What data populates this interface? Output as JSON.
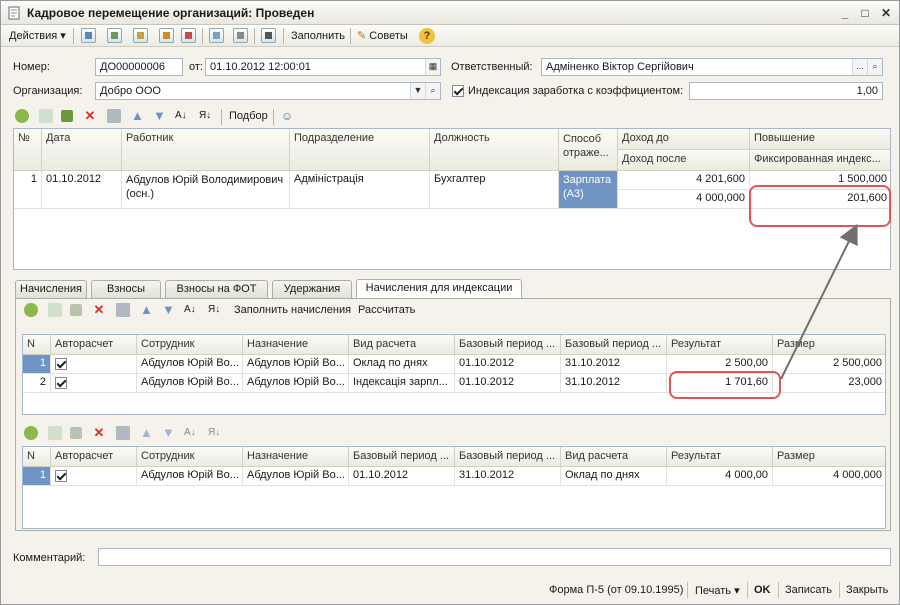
{
  "window": {
    "title": "Кадровое перемещение организаций: Проведен"
  },
  "toolbar": {
    "actions_label": "Действия",
    "fill_label": "Заполнить",
    "tips_label": "Советы"
  },
  "header": {
    "number_label": "Номер:",
    "number_value": "ДО00000006",
    "date_label": "от:",
    "date_value": "01.10.2012 12:00:01",
    "responsible_label": "Ответственный:",
    "responsible_value": "Адміненко Віктор Сергійович",
    "org_label": "Организация:",
    "org_value": "Добро ООО",
    "indexation_label": "Индексация заработка с коэффициентом:",
    "indexation_checked": true,
    "coefficient_value": "1,00"
  },
  "employees_toolbar": {
    "pick_label": "Подбор"
  },
  "employees_grid": {
    "headers": {
      "n": "№",
      "date": "Дата",
      "worker": "Работник",
      "department": "Подразделение",
      "position": "Должность",
      "method": "Способ отраже...",
      "income_before": "Доход до",
      "income_after": "Доход после",
      "increase": "Повышение",
      "fixed_index": "Фиксированная индекс..."
    },
    "rows": [
      {
        "n": "1",
        "date": "01.10.2012",
        "worker_line1": "Абдулов Юрій Володимирович",
        "worker_line2": "(осн.)",
        "department": "Адміністрація",
        "position": "Бухгалтер",
        "method_line1": "Зарплата",
        "method_line2": "(А3)",
        "income_before": "4 201,600",
        "income_after": "4 000,000",
        "increase": "1 500,000",
        "fixed_index": "201,600"
      }
    ]
  },
  "tabs": [
    {
      "label": "Начисления",
      "active": false
    },
    {
      "label": "Взносы",
      "active": false
    },
    {
      "label": "Взносы на ФОТ",
      "active": false
    },
    {
      "label": "Удержания",
      "active": false
    },
    {
      "label": "Начисления для индексации",
      "active": true
    }
  ],
  "accruals_toolbar": {
    "fill_accruals_label": "Заполнить начисления",
    "calculate_label": "Рассчитать"
  },
  "accruals_grid": {
    "headers": {
      "n": "N",
      "auto": "Авторасчет",
      "employee": "Сотрудник",
      "purpose": "Назначение",
      "calc_type": "Вид расчета",
      "base_start": "Базовый период ...",
      "base_end": "Базовый период ...",
      "result": "Результат",
      "amount": "Размер"
    },
    "rows": [
      {
        "n": "1",
        "auto": true,
        "employee": "Абдулов Юрій Во...",
        "purpose": "Абдулов Юрій Во...",
        "calc_type": "Оклад по днях",
        "base_start": "01.10.2012",
        "base_end": "31.10.2012",
        "result": "2 500,00",
        "amount": "2 500,000"
      },
      {
        "n": "2",
        "auto": true,
        "employee": "Абдулов Юрій Во...",
        "purpose": "Абдулов Юрій Во...",
        "calc_type": "Індексація зарпл...",
        "base_start": "01.10.2012",
        "base_end": "31.10.2012",
        "result": "1 701,60",
        "amount": "23,000"
      }
    ]
  },
  "base_grid": {
    "headers": {
      "n": "N",
      "auto": "Авторасчет",
      "employee": "Сотрудник",
      "purpose": "Назначение",
      "base_start": "Базовый период ...",
      "base_end": "Базовый период ...",
      "calc_type": "Вид расчета",
      "result": "Результат",
      "amount": "Размер"
    },
    "rows": [
      {
        "n": "1",
        "auto": true,
        "employee": "Абдулов Юрій Во...",
        "purpose": "Абдулов Юрій Во...",
        "base_start": "01.10.2012",
        "base_end": "31.10.2012",
        "calc_type": "Оклад по днях",
        "result": "4 000,00",
        "amount": "4 000,000"
      }
    ]
  },
  "comment": {
    "label": "Комментарий:",
    "value": ""
  },
  "footer": {
    "form_label": "Форма П-5 (от 09.10.1995)",
    "print_label": "Печать",
    "ok_label": "OK",
    "save_label": "Записать",
    "close_label": "Закрыть"
  },
  "colors": {
    "selection": "#6f93c3",
    "highlight": "#e05555",
    "accent_arrow": "#707070"
  }
}
